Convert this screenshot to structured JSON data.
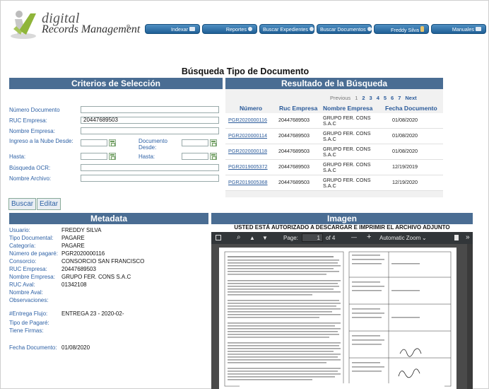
{
  "logo": {
    "line1": "digital",
    "line2": "Records Management",
    "mark": "®"
  },
  "nav": [
    {
      "label": "Indexar",
      "icon": "monitor-icon"
    },
    {
      "label": "Reportes",
      "icon": "report-icon"
    },
    {
      "label": "Buscar Expedientes",
      "icon": "search-icon"
    },
    {
      "label": "Buscar Documentos",
      "icon": "search-icon"
    },
    {
      "label": "Freddy Silva",
      "icon": "user-icon"
    },
    {
      "label": "Manuales",
      "icon": "help-icon"
    }
  ],
  "page_title": "Búsqueda Tipo de Documento",
  "criteria": {
    "header": "Criterios de Selección",
    "numero_documento_label": "Número Documento",
    "numero_documento_value": "",
    "ruc_empresa_label": "RUC Empresa:",
    "ruc_empresa_value": "20447689503",
    "nombre_empresa_label": "Nombre Empresa:",
    "nombre_empresa_value": "",
    "ingreso_desde_label": "Ingreso a la Nube Desde:",
    "documento_desde_label": "Documento Desde:",
    "hasta_label": "Hasta:",
    "hasta2_label": "Hasta:",
    "busqueda_ocr_label": "Búsqueda OCR:",
    "nombre_archivo_label": "Nombre Archivo:"
  },
  "buttons": {
    "buscar": "Buscar",
    "editar": "Editar"
  },
  "results": {
    "header": "Resultado de la Búsqueda",
    "pager": {
      "previous": "Previous",
      "pages": [
        "1",
        "2",
        "3",
        "4",
        "5",
        "6",
        "7"
      ],
      "next": "Next",
      "current": "1"
    },
    "columns": [
      "Número",
      "Ruc Empresa",
      "Nombre Empresa",
      "Fecha Documento"
    ],
    "rows": [
      {
        "numero": "PGR2020000116",
        "ruc": "20447689503",
        "empresa": "GRUPO FER. CONS S.A.C",
        "fecha": "01/08/2020"
      },
      {
        "numero": "PGR2020000114",
        "ruc": "20447689503",
        "empresa": "GRUPO FER. CONS S.A.C",
        "fecha": "01/08/2020"
      },
      {
        "numero": "PGR2020000118",
        "ruc": "20447689503",
        "empresa": "GRUPO FER. CONS S.A.C",
        "fecha": "01/08/2020"
      },
      {
        "numero": "PGR2019005372",
        "ruc": "20447689503",
        "empresa": "GRUPO FER. CONS S.A.C",
        "fecha": "12/19/2019"
      },
      {
        "numero": "PGR2019005368",
        "ruc": "20447689503",
        "empresa": "GRUPO FER. CONS S.A.C",
        "fecha": "12/19/2020"
      }
    ]
  },
  "metadata": {
    "header": "Metadata",
    "fields": [
      {
        "label": "Usuario:",
        "value": "FREDDY SILVA"
      },
      {
        "label": "Tipo Documental:",
        "value": "PAGARE"
      },
      {
        "label": "Categoría:",
        "value": "PAGARE"
      },
      {
        "label": "Número de pagaré:",
        "value": "PGR2020000116"
      },
      {
        "label": "Consorcio:",
        "value": "CONSORCIO SAN FRANCISCO"
      },
      {
        "label": "RUC Empresa:",
        "value": "20447689503"
      },
      {
        "label": "Nombre Empresa:",
        "value": "GRUPO FER. CONS S.A.C"
      },
      {
        "label": "RUC Aval:",
        "value": "01342108"
      },
      {
        "label": "Nombre Aval:",
        "value": ""
      },
      {
        "label": "Observaciones:",
        "value": ""
      },
      {
        "label": "#Entrega Flujo:",
        "value": "ENTREGA 23 - 2020-02-"
      },
      {
        "label": "Tipo de Pagaré:",
        "value": ""
      },
      {
        "label": "Tiene Firmas:",
        "value": ""
      },
      {
        "label": "Fecha Documento:",
        "value": "01/08/2020"
      }
    ]
  },
  "imagen": {
    "header": "Imagen",
    "notice": "USTED ESTÁ AUTORIZADO A DESCARGAR E IMPRIMIR EL ARCHIVO ADJUNTO",
    "viewer": {
      "page_label": "Page:",
      "page_value": "1",
      "page_total": "of 4",
      "zoom": "Automatic Zoom",
      "minus": "—",
      "plus": "+"
    }
  },
  "colors": {
    "bar": "#4a6d93",
    "label": "#2f62a6",
    "nav": "#2c6ca3"
  }
}
